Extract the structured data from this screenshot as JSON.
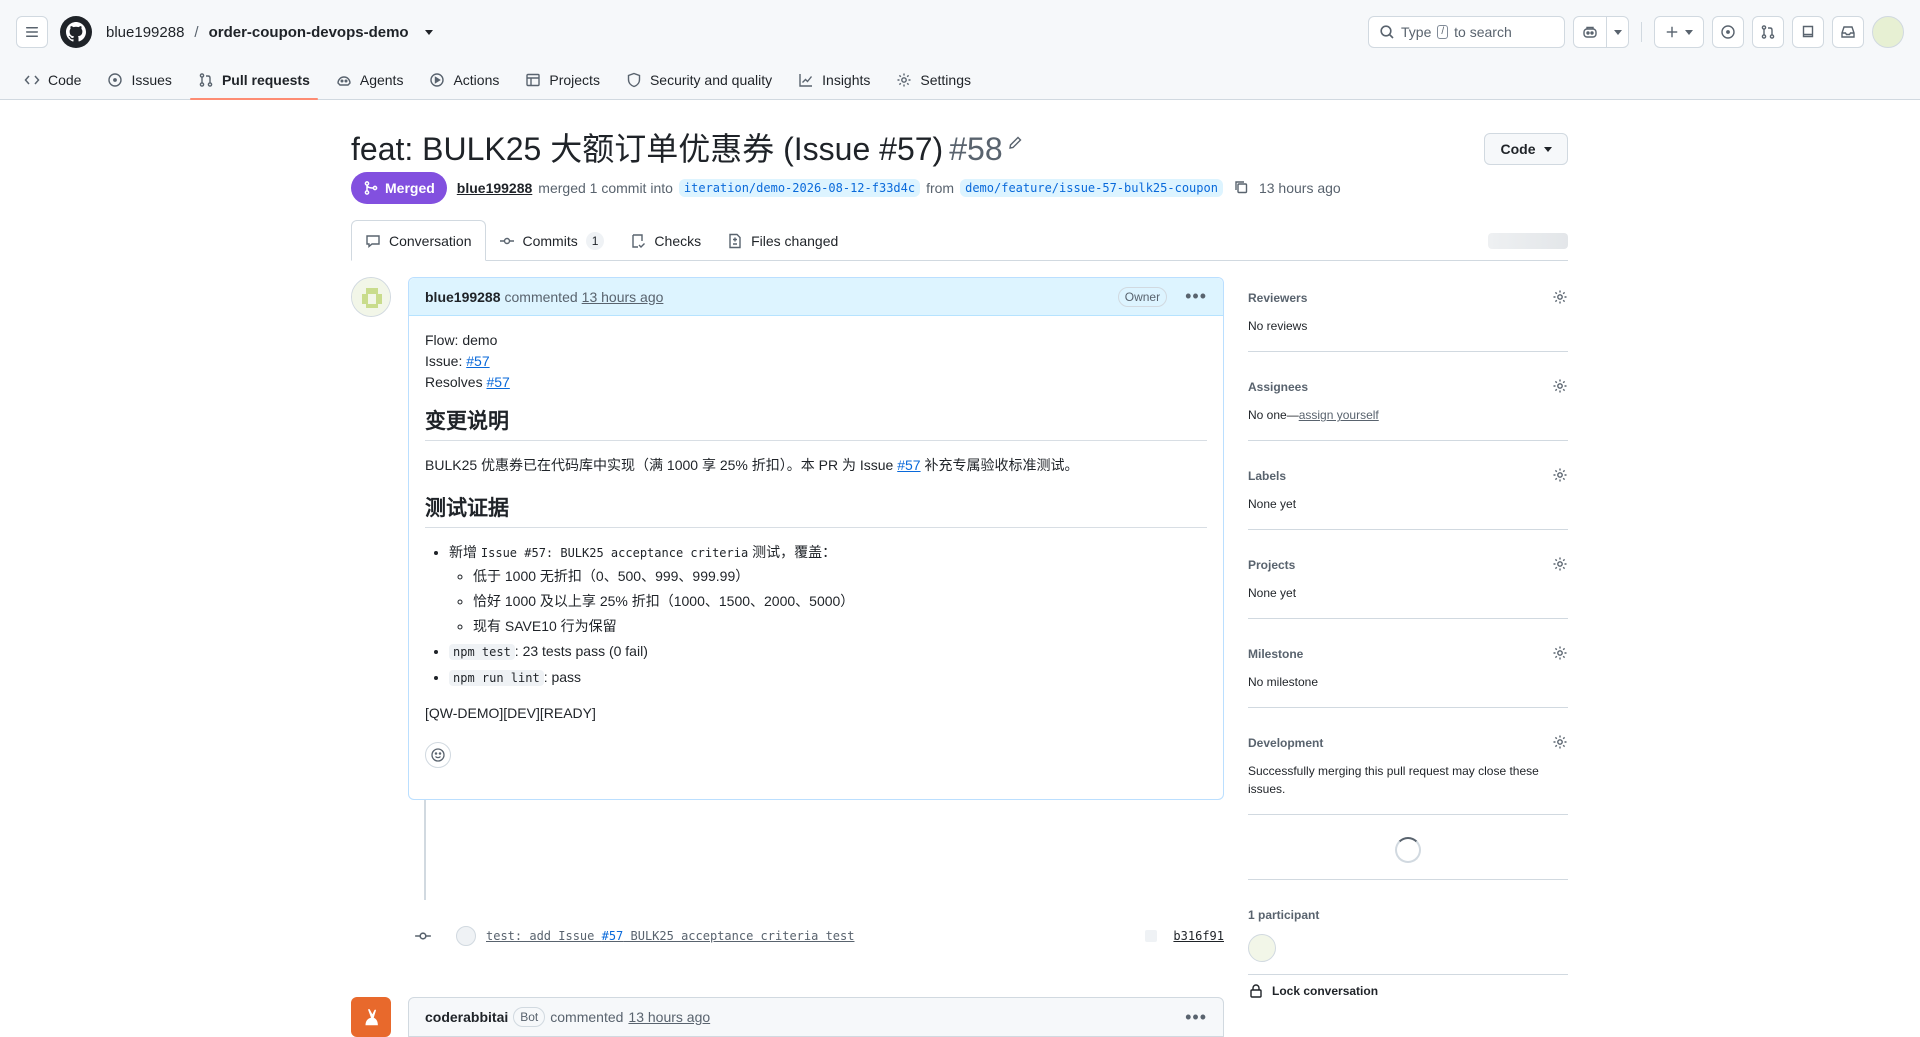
{
  "header": {
    "owner": "blue199288",
    "separator": "/",
    "repo": "order-coupon-devops-demo",
    "search_prefix": "Type",
    "search_key": "/",
    "search_suffix": "to search"
  },
  "nav": [
    {
      "label": "Code",
      "icon": "code-icon"
    },
    {
      "label": "Issues",
      "icon": "issue-icon"
    },
    {
      "label": "Pull requests",
      "icon": "pull-request-icon",
      "active": true
    },
    {
      "label": "Agents",
      "icon": "agent-icon"
    },
    {
      "label": "Actions",
      "icon": "play-icon"
    },
    {
      "label": "Projects",
      "icon": "table-icon"
    },
    {
      "label": "Security and quality",
      "icon": "shield-icon"
    },
    {
      "label": "Insights",
      "icon": "graph-icon"
    },
    {
      "label": "Settings",
      "icon": "gear-icon"
    }
  ],
  "pr": {
    "title": "feat: BULK25 大额订单优惠券 (Issue #57)",
    "number": "#58",
    "state": "Merged",
    "author": "blue199288",
    "action": "merged 1 commit into",
    "base": "iteration/demo-2026-08-12-f33d4c",
    "from": "from",
    "head": "demo/feature/issue-57-bulk25-coupon",
    "time": "13 hours ago",
    "code_button": "Code"
  },
  "tabs": {
    "conversation": "Conversation",
    "commits": "Commits",
    "commits_count": "1",
    "checks": "Checks",
    "files": "Files changed"
  },
  "comment": {
    "author": "blue199288",
    "verb": "commented",
    "time": "13 hours ago",
    "role": "Owner",
    "line1": "Flow: demo",
    "line2_label": "Issue: ",
    "line2_link": "#57",
    "line3_label": "Resolves ",
    "line3_link": "#57",
    "h_changes": "变更说明",
    "changes_text_a": "BULK25 优惠券已在代码库中实现（满 1000 享 25% 折扣）。本 PR 为 Issue ",
    "changes_link": "#57",
    "changes_text_b": " 补充专属验收标准测试。",
    "h_evidence": "测试证据",
    "bullet1_a": "新增 ",
    "bullet1_code": "Issue #57: BULK25 acceptance criteria",
    "bullet1_b": " 测试，覆盖：",
    "sub1": "低于 1000 无折扣（0、500、999、999.99）",
    "sub2": "恰好 1000 及以上享 25% 折扣（1000、1500、2000、5000）",
    "sub3": "现有 SAVE10 行为保留",
    "bullet2_code": "npm test",
    "bullet2_text": ": 23 tests pass (0 fail)",
    "bullet3_code": "npm run lint",
    "bullet3_text": ": pass",
    "tag": "[QW-DEMO][DEV][READY]"
  },
  "commit": {
    "msg_a": "test: add Issue ",
    "msg_issue": "#57",
    "msg_b": " BULK25 acceptance criteria test",
    "sha": "b316f91"
  },
  "comment2": {
    "author": "coderabbitai",
    "badge": "Bot",
    "verb": "commented",
    "time": "13 hours ago"
  },
  "sidebar": {
    "reviewers_title": "Reviewers",
    "reviewers_value": "No reviews",
    "assignees_title": "Assignees",
    "assignees_prefix": "No one—",
    "assignees_link": "assign yourself",
    "labels_title": "Labels",
    "labels_value": "None yet",
    "projects_title": "Projects",
    "projects_value": "None yet",
    "milestone_title": "Milestone",
    "milestone_value": "No milestone",
    "development_title": "Development",
    "development_value": "Successfully merging this pull request may close these issues.",
    "participants": "1 participant",
    "lock": "Lock conversation"
  }
}
